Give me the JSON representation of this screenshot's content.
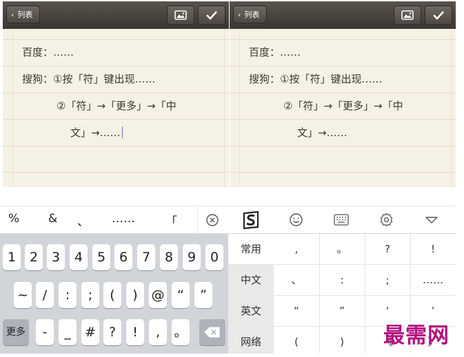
{
  "note_panels": [
    {
      "back_label": "列表",
      "lines": [
        "百度：……",
        "搜狗：①按「符」键出现……",
        "②「符」→「更多」→「中",
        "文」→……"
      ]
    },
    {
      "back_label": "列表",
      "lines": [
        "百度：……",
        "搜狗：①按「符」键出现……",
        "②「符」→「更多」→「中",
        "文」→……"
      ]
    }
  ],
  "toolbar": {
    "symbols": [
      "%",
      "&",
      "、",
      "……",
      "「"
    ],
    "icons": [
      "clear-icon",
      "sogou-logo-icon",
      "emoji-icon",
      "keyboard-icon",
      "settings-icon",
      "collapse-icon"
    ]
  },
  "keyboard": {
    "row1": [
      "1",
      "2",
      "3",
      "4",
      "5",
      "6",
      "7",
      "8",
      "9",
      "0"
    ],
    "row2": [
      "~",
      "/",
      ":",
      ";",
      "(",
      ")",
      "@",
      "“",
      "”"
    ],
    "row3": [
      "更多",
      "-",
      "_",
      "#",
      "?",
      "!",
      ",",
      "。"
    ],
    "delete_icon": "backspace-icon"
  },
  "categories": [
    "常用",
    "中文",
    "英文",
    "网络"
  ],
  "active_category": "常用",
  "grid": [
    [
      ",",
      "。",
      "?",
      "!"
    ],
    [
      "、",
      ":",
      ";",
      "……"
    ],
    [
      "“",
      "”",
      "‘",
      "’"
    ],
    [
      "(",
      ")",
      "《",
      "》"
    ]
  ],
  "watermark": "最需网"
}
